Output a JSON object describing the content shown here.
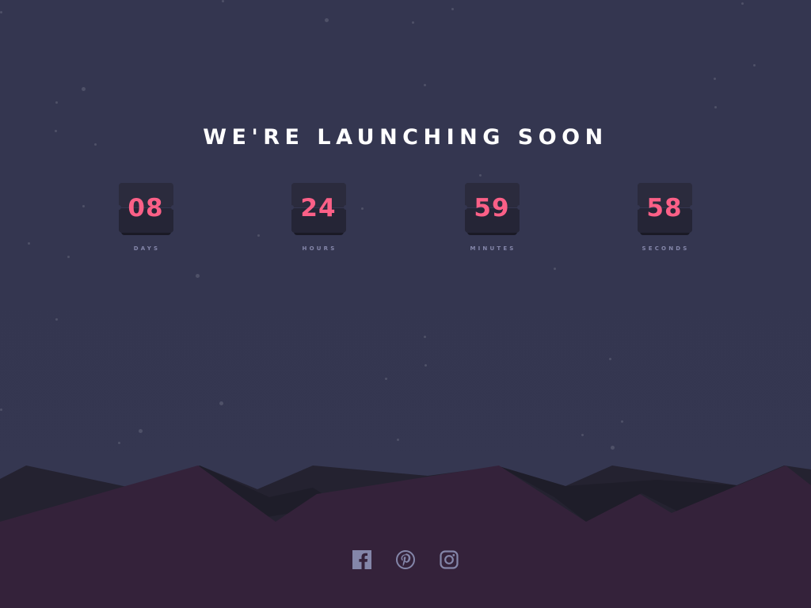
{
  "heading": "WE'RE LAUNCHING SOON",
  "countdown": [
    {
      "value": "08",
      "label": "DAYS"
    },
    {
      "value": "24",
      "label": "HOURS"
    },
    {
      "value": "59",
      "label": "MINUTES"
    },
    {
      "value": "58",
      "label": "SECONDS"
    }
  ],
  "social_links": [
    {
      "icon": "facebook-icon"
    },
    {
      "icon": "pinterest-icon"
    },
    {
      "icon": "instagram-icon"
    }
  ],
  "colors": {
    "background": "#343650",
    "accent": "#fb6087",
    "label": "#8486a9",
    "card": "#2b2b3d",
    "hills_front": "#34223a",
    "hills_back": "#242230",
    "social_icon": "#8486a9"
  }
}
